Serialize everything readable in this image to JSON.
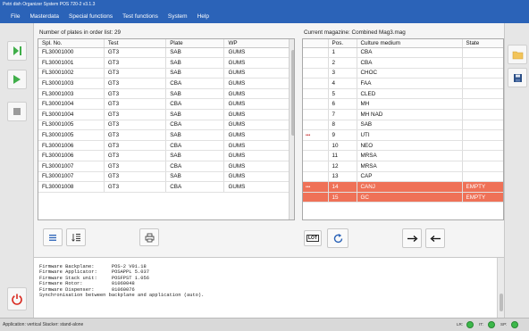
{
  "window": {
    "title": "Petri dish Organizer System POS 720-2 v3.1.3"
  },
  "menu": [
    "File",
    "Masterdata",
    "Special functions",
    "Test functions",
    "System",
    "Help"
  ],
  "orders": {
    "caption": "Number of plates in order list: 29",
    "columns": [
      "Spl. No.",
      "Test",
      "Plate",
      "WP"
    ],
    "rows": [
      [
        "FL30001000",
        "GT3",
        "SAB",
        "GUMS"
      ],
      [
        "FL30001001",
        "GT3",
        "SAB",
        "GUMS"
      ],
      [
        "FL30001002",
        "GT3",
        "SAB",
        "GUMS"
      ],
      [
        "FL30001003",
        "GT3",
        "CBA",
        "GUMS"
      ],
      [
        "FL30001003",
        "GT3",
        "SAB",
        "GUMS"
      ],
      [
        "FL30001004",
        "GT3",
        "CBA",
        "GUMS"
      ],
      [
        "FL30001004",
        "GT3",
        "SAB",
        "GUMS"
      ],
      [
        "FL30001005",
        "GT3",
        "CBA",
        "GUMS"
      ],
      [
        "FL30001005",
        "GT3",
        "SAB",
        "GUMS"
      ],
      [
        "FL30001006",
        "GT3",
        "CBA",
        "GUMS"
      ],
      [
        "FL30001006",
        "GT3",
        "SAB",
        "GUMS"
      ],
      [
        "FL30001007",
        "GT3",
        "CBA",
        "GUMS"
      ],
      [
        "FL30001007",
        "GT3",
        "SAB",
        "GUMS"
      ],
      [
        "FL30001008",
        "GT3",
        "CBA",
        "GUMS"
      ]
    ]
  },
  "magazine": {
    "caption": "Current magazine: Combined Mag3.mag",
    "columns": [
      "",
      "Pos.",
      "Culture medium",
      "State"
    ],
    "rows": [
      [
        "",
        "1",
        "CBA",
        ""
      ],
      [
        "",
        "2",
        "CBA",
        ""
      ],
      [
        "",
        "3",
        "CHOC",
        ""
      ],
      [
        "",
        "4",
        "FAA",
        ""
      ],
      [
        "",
        "5",
        "CLED",
        ""
      ],
      [
        "",
        "6",
        "MH",
        ""
      ],
      [
        "",
        "7",
        "MH NAD",
        ""
      ],
      [
        "",
        "8",
        "SAB",
        ""
      ],
      [
        "•••",
        "9",
        "UTI",
        ""
      ],
      [
        "",
        "10",
        "NEO",
        ""
      ],
      [
        "",
        "11",
        "MRSA",
        ""
      ],
      [
        "",
        "12",
        "MRSA",
        ""
      ],
      [
        "",
        "13",
        "CAP",
        ""
      ],
      [
        "•••",
        "14",
        "CANJ",
        "EMPTY"
      ],
      [
        "",
        "15",
        "GC",
        "EMPTY"
      ]
    ],
    "empty_row_color": "#ef7157"
  },
  "toolbar": {
    "lot_label": "LOT"
  },
  "log": {
    "lines": [
      "Firmware Backplane:      POS-2 V01.18",
      "Firmware Applicator:     POSAPPL 5.037",
      "Firmware Stack unit:     POSFPST 1.056",
      "Firmware Rotor:          01060048",
      "Firmware Dispenser:      01060076",
      "Synchronisation between backplane and application (auto)."
    ]
  },
  "status": {
    "text": "Application: vertical   Stacker: stand-alone",
    "indicators": [
      "LR:",
      "IT:",
      "SP:"
    ]
  },
  "colors": {
    "accent": "#2b63b8",
    "play": "#3fae49",
    "stop": "#9a9a9a",
    "power": "#d8281e"
  },
  "icons": {
    "left": [
      "step-forward-icon",
      "play-icon",
      "stop-icon",
      "power-icon"
    ],
    "right": [
      "folder-icon",
      "save-icon"
    ],
    "toolbar": [
      "list-icon",
      "sort-list-icon",
      "print-icon",
      "lot-icon",
      "refresh-icon",
      "arrow-right-icon",
      "arrow-left-icon"
    ]
  }
}
